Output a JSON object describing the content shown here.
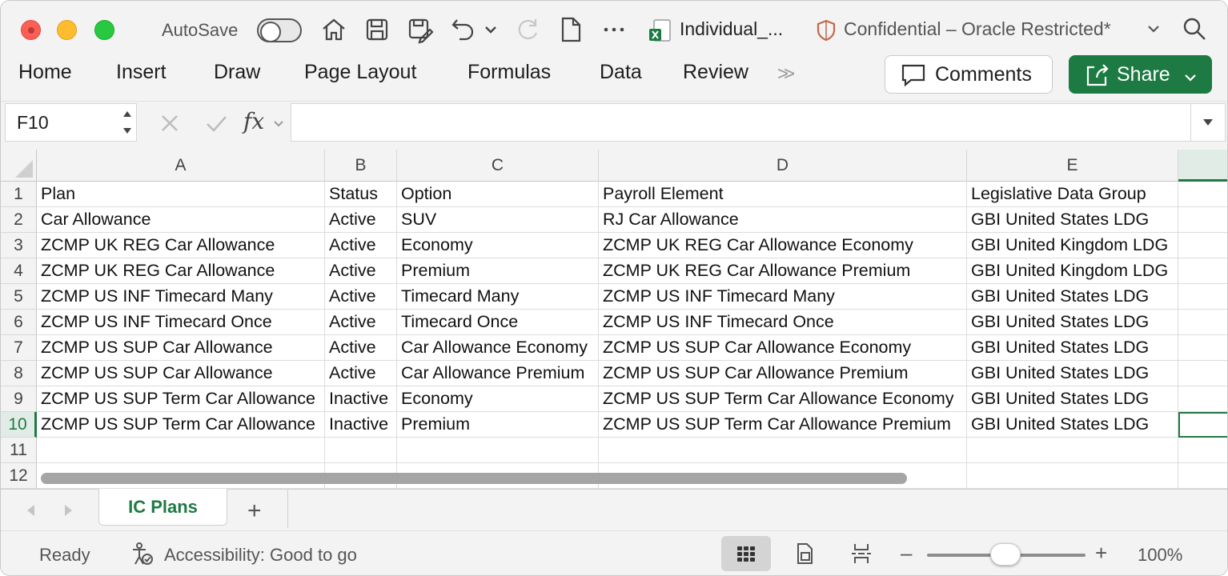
{
  "titlebar": {
    "autosave_label": "AutoSave",
    "document_name": "Individual_...",
    "sensitivity_label": "Confidential – Oracle Restricted*"
  },
  "ribbon": {
    "tabs": [
      "Home",
      "Insert",
      "Draw",
      "Page Layout",
      "Formulas",
      "Data",
      "Review"
    ],
    "more": ">>",
    "comments_label": "Comments",
    "share_label": "Share"
  },
  "formula_bar": {
    "name_box": "F10",
    "fx_label": "fx",
    "formula_value": ""
  },
  "sheet": {
    "columns": [
      {
        "letter": "A"
      },
      {
        "letter": "B"
      },
      {
        "letter": "C"
      },
      {
        "letter": "D"
      },
      {
        "letter": "E"
      },
      {
        "letter": ""
      }
    ],
    "row_numbers": [
      "1",
      "2",
      "3",
      "4",
      "5",
      "6",
      "7",
      "8",
      "9",
      "10",
      "11",
      "12"
    ],
    "rows": [
      [
        "Plan",
        "Status",
        "Option",
        "Payroll Element",
        "Legislative Data Group",
        ""
      ],
      [
        "Car Allowance",
        "Active",
        "SUV",
        "RJ Car Allowance",
        "GBI United States LDG",
        ""
      ],
      [
        "ZCMP UK REG Car Allowance",
        "Active",
        "Economy",
        "ZCMP UK REG Car Allowance Economy",
        "GBI United Kingdom LDG",
        ""
      ],
      [
        "ZCMP UK REG Car Allowance",
        "Active",
        "Premium",
        "ZCMP UK REG Car Allowance Premium",
        "GBI United Kingdom LDG",
        ""
      ],
      [
        "ZCMP US INF Timecard Many",
        "Active",
        "Timecard Many",
        "ZCMP US INF Timecard Many",
        "GBI United States LDG",
        ""
      ],
      [
        "ZCMP US INF Timecard Once",
        "Active",
        "Timecard Once",
        "ZCMP US INF Timecard Once",
        "GBI United States LDG",
        ""
      ],
      [
        "ZCMP US SUP Car Allowance",
        "Active",
        "Car Allowance Economy",
        "ZCMP US SUP Car Allowance Economy",
        "GBI United States LDG",
        ""
      ],
      [
        "ZCMP US SUP Car Allowance",
        "Active",
        "Car Allowance Premium",
        "ZCMP US SUP Car Allowance Premium",
        "GBI United States LDG",
        ""
      ],
      [
        "ZCMP US SUP Term Car Allowance",
        "Inactive",
        "Economy",
        "ZCMP US SUP Term Car Allowance Economy",
        "GBI United States LDG",
        ""
      ],
      [
        "ZCMP US SUP Term Car Allowance",
        "Inactive",
        "Premium",
        "ZCMP US SUP Term Car Allowance Premium",
        "GBI United States LDG",
        ""
      ],
      [
        "",
        "",
        "",
        "",
        "",
        ""
      ],
      [
        "",
        "",
        "",
        "",
        "",
        ""
      ]
    ],
    "active_row": 10
  },
  "sheet_tabs": {
    "tabs": [
      "IC Plans"
    ],
    "add_label": "+"
  },
  "status_bar": {
    "status": "Ready",
    "accessibility": "Accessibility: Good to go",
    "zoom_level": "100%",
    "zoom_minus": "–",
    "zoom_plus": "+"
  },
  "colors": {
    "accent": "#1e7a43",
    "share_button": "#1e7a43",
    "traffic_close": "#fe5f57",
    "traffic_min": "#febc2e",
    "traffic_max": "#28c840"
  },
  "icons": [
    "home-icon",
    "save-icon",
    "save-as-icon",
    "undo-icon",
    "redo-icon",
    "new-doc-icon",
    "more-icon",
    "excel-file-icon",
    "shield-icon",
    "search-icon",
    "comment-icon",
    "share-icon",
    "fx-icon",
    "cancel-icon",
    "confirm-icon",
    "accessibility-icon",
    "normal-view-icon",
    "page-layout-view-icon",
    "page-break-view-icon"
  ]
}
